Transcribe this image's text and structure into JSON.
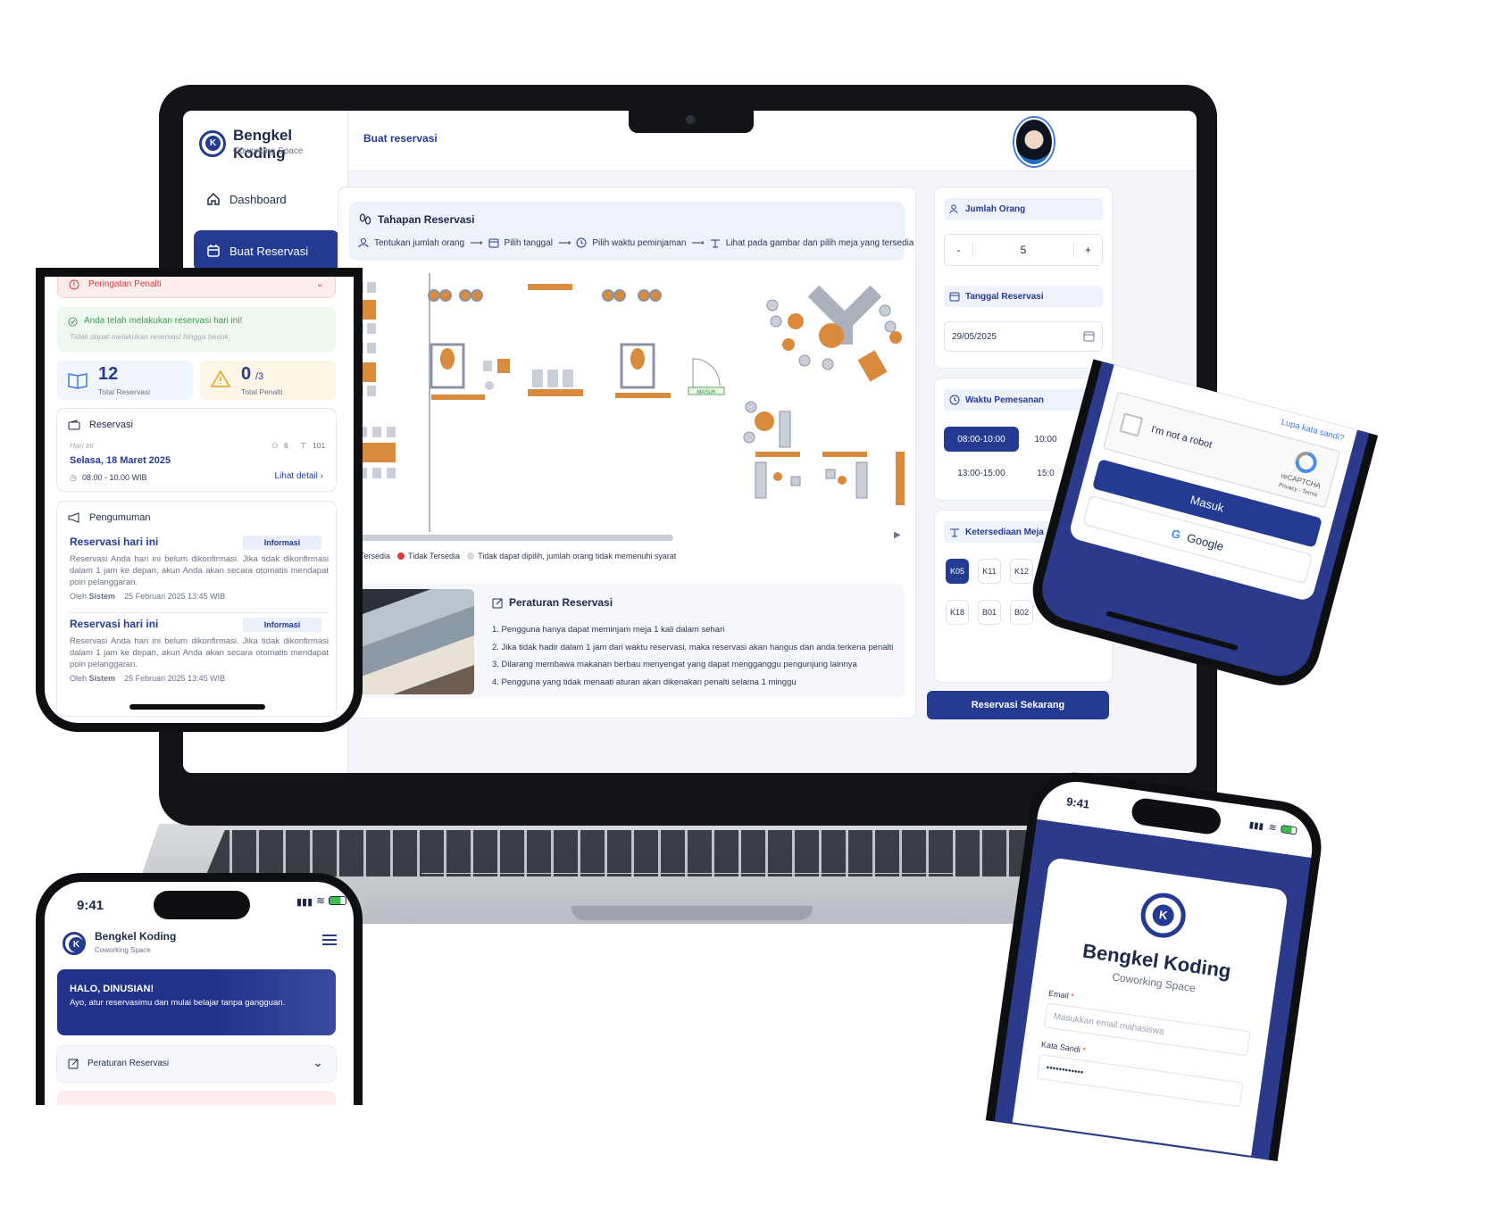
{
  "laptop": {
    "brand": {
      "name": "Bengkel Koding",
      "tagline": "Coworking Space"
    },
    "nav": [
      {
        "label": "Dashboard",
        "icon": "home-icon",
        "active": false
      },
      {
        "label": "Buat Reservasi",
        "icon": "calendar-icon",
        "active": true
      }
    ],
    "header": {
      "title": "Buat reservasi"
    },
    "steps": {
      "title": "Tahapan Reservasi",
      "items": [
        "Tentukan jumlah orang",
        "Pilih tanggal",
        "Pilih waktu peminjaman",
        "Lihat pada gambar dan pilih meja yang tersedia"
      ]
    },
    "floorplan": {
      "door_label": "MASUK"
    },
    "legend": {
      "available": "Tersedia",
      "unavailable": "Tidak Tersedia",
      "ineligible": "Tidak dapat dipilih, jumlah orang tidak memenuhi syarat",
      "colors": {
        "available": "#d98a3c",
        "unavailable": "#d9393b",
        "ineligible": "#d3d7de"
      }
    },
    "rules": {
      "title": "Peraturan Reservasi",
      "items": [
        "1. Pengguna hanya dapat meminjam meja 1 kali dalam sehari",
        "2. Jika tidak hadir dalam 1 jam dari waktu reservasi, maka reservasi akan hangus dan anda terkena penalti",
        "3. Dilarang membawa makanan berbau menyengat yang dapat mengganggu pengunjung lainnya",
        "4. Pengguna yang tidak menaati aturan akan dikenakan penalti selama 1 minggu"
      ]
    },
    "people": {
      "title": "Jumlah Orang",
      "minus": "-",
      "value": "5",
      "plus": "+"
    },
    "date": {
      "title": "Tanggal Reservasi",
      "value": "29/05/2025"
    },
    "time": {
      "title": "Waktu Pemesanan",
      "slots": [
        "08:00-10:00",
        "10:00",
        "13:00-15:00",
        "15:0"
      ],
      "selected": "08:00-10:00"
    },
    "tables": {
      "title": "Ketersediaan Meja",
      "items": [
        "K05",
        "K11",
        "K12",
        "K18",
        "B01",
        "B02"
      ],
      "selected": "K05"
    },
    "cta": "Reservasi Sekarang",
    "accent": "#233b92"
  },
  "phone_dashboard": {
    "penalty_warning": "Peringatan Penalti",
    "reserved_notice": {
      "title": "Anda telah melakukan reservasi hari ini!",
      "subtitle": "Tidak dapat melakukan reservasi hingga besok."
    },
    "stats": [
      {
        "value": "12",
        "suffix": "",
        "label": "Total Reservasi"
      },
      {
        "value": "0",
        "suffix": "/3",
        "label": "Total Penalti"
      }
    ],
    "reservation": {
      "title": "Reservasi",
      "when": "Hari ini",
      "people": "6",
      "table": "101",
      "date": "Selasa, 18 Maret 2025",
      "time": "08.00 - 10.00 WIB",
      "link": "Lihat detail ›"
    },
    "announcements": {
      "title": "Pengumuman",
      "items": [
        {
          "title": "Reservasi hari ini",
          "tag": "Informasi",
          "body": "Reservasi Anda hari ini belum dikonfirmasi. Jika tidak dikonfirmasi dalam 1 jam ke depan, akun Anda akan secara otomatis mendapat poin pelanggaran.",
          "by_label": "Oleh",
          "by": "Sistem",
          "date": "25 Februari 2025 13:45 WIB"
        },
        {
          "title": "Reservasi hari ini",
          "tag": "Informasi",
          "body": "Reservasi Anda hari ini belum dikonfirmasi. Jika tidak dikonfirmasi dalam 1 jam ke depan, akun Anda akan secara otomatis mendapat poin pelanggaran.",
          "by_label": "Oleh",
          "by": "Sistem",
          "date": "25 Februari 2025 13:45 WIB"
        }
      ]
    }
  },
  "phone_home": {
    "time": "9:41",
    "brand": {
      "name": "Bengkel Koding",
      "tagline": "Coworking Space"
    },
    "hero": {
      "greeting": "HALO, DINUSIAN!",
      "text": "Ayo, atur reservasimu dan mulai belajar tanpa gangguan."
    },
    "rules_accordion": "Peraturan Reservasi"
  },
  "phone_recaptcha": {
    "forgot": "Lupa kata sandi?",
    "captcha": {
      "label": "I'm not a robot",
      "brand": "reCAPTCHA",
      "links": "Privacy - Terms"
    },
    "login": "Masuk",
    "google": "Google"
  },
  "phone_login": {
    "time": "9:41",
    "brand": {
      "name": "Bengkel Koding",
      "tagline": "Coworking Space"
    },
    "email": {
      "label": "Email",
      "required": "*",
      "placeholder": "Masukkan email mahasiswa"
    },
    "password": {
      "label": "Kata Sandi",
      "required": "*",
      "value": "••••••••••••"
    }
  }
}
